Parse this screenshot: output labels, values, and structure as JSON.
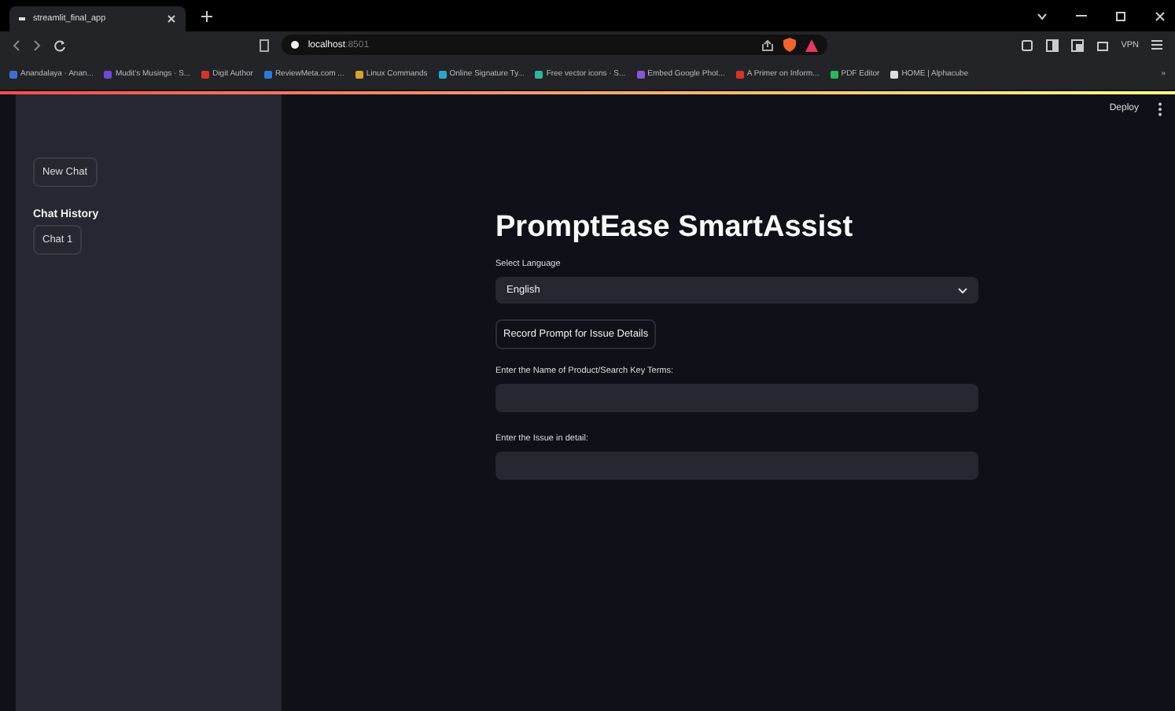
{
  "browser": {
    "tabs": [
      {
        "title": "streamlit_final_app",
        "selected": true
      }
    ],
    "address": {
      "host": "localhost",
      "port": ":8501"
    },
    "vpn_label": "VPN",
    "bookmarks": [
      "Anandalaya · Anan...",
      "Mudit's Musings · S...",
      "Digit Author",
      "ReviewMeta.com ...",
      "Linux Commands",
      "Online Signature Ty...",
      "Free vector icons · S...",
      "Embed Google Phot...",
      "A Primer on Inform...",
      "PDF Editor",
      "HOME | Alphacube"
    ],
    "bookmarks_more": "»"
  },
  "app": {
    "deploy": "Deploy",
    "sidebar": {
      "new_chat": "New Chat",
      "history_title": "Chat History",
      "chats": [
        "Chat 1"
      ]
    },
    "title": "PromptEase SmartAssist",
    "language": {
      "label": "Select Language",
      "value": "English"
    },
    "record_button": "Record Prompt for Issue Details",
    "fields": [
      {
        "label": "Enter the Name of Product/Search Key Terms:"
      },
      {
        "label": "Enter the Issue in detail:"
      }
    ]
  }
}
